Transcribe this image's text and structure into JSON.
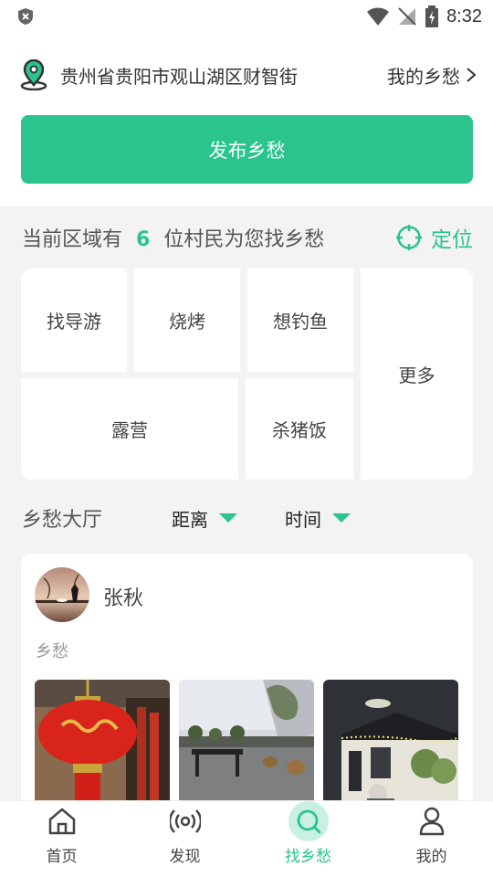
{
  "status_bar": {
    "time": "8:32"
  },
  "header": {
    "location": "贵州省贵阳市观山湖区财智街",
    "my_link": "我的乡愁",
    "publish_button": "发布乡愁"
  },
  "region": {
    "prefix": "当前区域有",
    "count": "6",
    "suffix": "位村民为您找乡愁",
    "locate_label": "定位"
  },
  "categories": [
    "找导游",
    "烧烤",
    "想钓鱼",
    "更多",
    "露营",
    "杀猪饭"
  ],
  "hall": {
    "title": "乡愁大厅",
    "filters": [
      "距离",
      "时间"
    ]
  },
  "post": {
    "user": "张秋",
    "tag": "乡愁"
  },
  "tabs": [
    "首页",
    "发现",
    "找乡愁",
    "我的"
  ],
  "colors": {
    "accent": "#2ac48c"
  }
}
